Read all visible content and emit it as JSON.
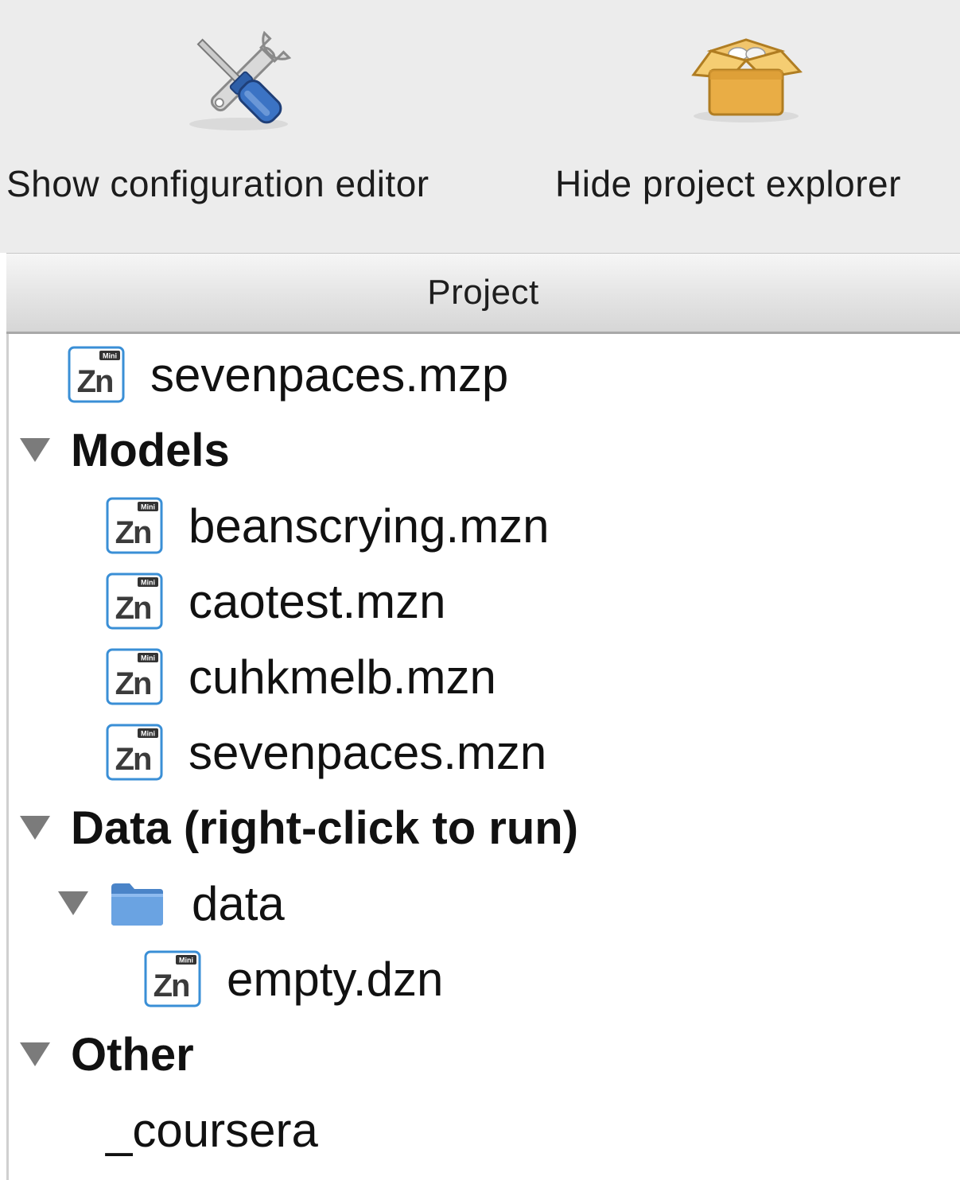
{
  "toolbar": {
    "config_button_label": "Show configuration editor",
    "config_button_icon": "wrench-screwdriver-icon",
    "explorer_button_label": "Hide project explorer",
    "explorer_button_icon": "open-box-icon"
  },
  "project_panel": {
    "title": "Project"
  },
  "tree": {
    "project_file": {
      "label": "sevenpaces.mzp",
      "icon": "minizinc-file-icon"
    },
    "models": {
      "label": "Models",
      "items": [
        {
          "label": "beanscrying.mzn"
        },
        {
          "label": "caotest.mzn"
        },
        {
          "label": "cuhkmelb.mzn"
        },
        {
          "label": "sevenpaces.mzn"
        }
      ]
    },
    "data": {
      "label": "Data (right-click to run)",
      "folder": {
        "label": "data",
        "items": [
          {
            "label": "empty.dzn"
          }
        ]
      }
    },
    "other": {
      "label": "Other",
      "items": [
        {
          "label": "_coursera"
        }
      ]
    }
  },
  "colors": {
    "zn_icon_border": "#3a8fd6",
    "zn_icon_text": "#333333",
    "folder": "#5f9ad8",
    "expander": "#7b7b7b",
    "toolbar_bg": "#ececec"
  }
}
